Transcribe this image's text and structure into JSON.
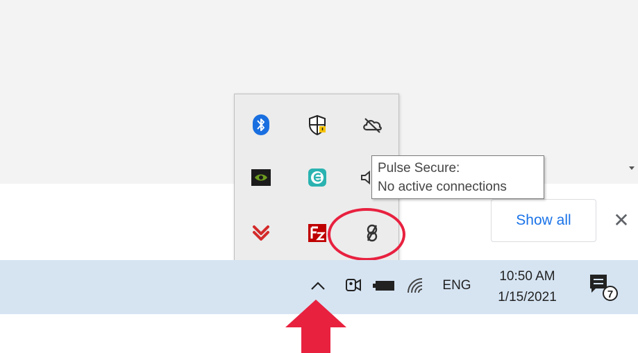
{
  "browser": {
    "show_all_label": "Show all",
    "close_glyph": "✕"
  },
  "tray_popup": {
    "icons": [
      {
        "name": "bluetooth-icon"
      },
      {
        "name": "windows-security-icon"
      },
      {
        "name": "cloud-offline-icon"
      },
      {
        "name": "nvidia-icon"
      },
      {
        "name": "eset-icon"
      },
      {
        "name": "speaker-icon"
      },
      {
        "name": "download-manager-icon"
      },
      {
        "name": "filezilla-icon"
      },
      {
        "name": "pulse-secure-icon"
      }
    ],
    "tooltip": {
      "line1": "Pulse Secure:",
      "line2": "No active connections"
    }
  },
  "taskbar": {
    "language": "ENG",
    "time": "10:50 AM",
    "date": "1/15/2021",
    "notification_count": "7"
  },
  "colors": {
    "taskbar_bg": "#d6e4f2",
    "highlight_red": "#e8213f",
    "link_blue": "#1a73e8"
  }
}
